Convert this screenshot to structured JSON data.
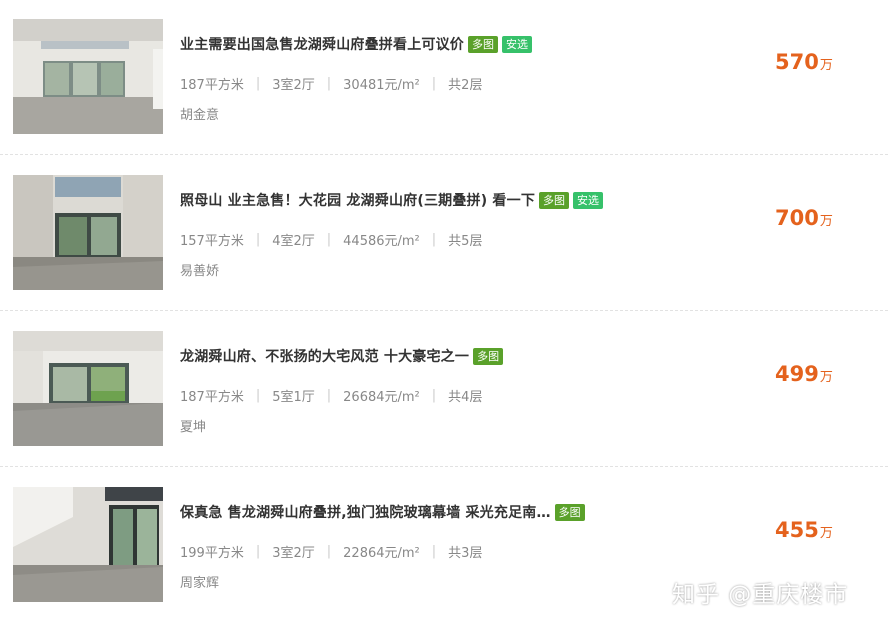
{
  "listings": [
    {
      "title": "业主需要出国急售龙湖舜山府叠拼看上可议价",
      "tags": [
        "多图",
        "安选"
      ],
      "area": "187平方米",
      "layout": "3室2厅",
      "unit_price": "30481元/m²",
      "floors": "共2层",
      "agent": "胡金意",
      "price": "570",
      "price_unit": "万"
    },
    {
      "title": "照母山 业主急售！大花园 龙湖舜山府(三期叠拼) 看一下",
      "tags": [
        "多图",
        "安选"
      ],
      "area": "157平方米",
      "layout": "4室2厅",
      "unit_price": "44586元/m²",
      "floors": "共5层",
      "agent": "易善娇",
      "price": "700",
      "price_unit": "万"
    },
    {
      "title": "龙湖舜山府、不张扬的大宅风范 十大豪宅之一",
      "tags": [
        "多图"
      ],
      "area": "187平方米",
      "layout": "5室1厅",
      "unit_price": "26684元/m²",
      "floors": "共4层",
      "agent": "夏坤",
      "price": "499",
      "price_unit": "万"
    },
    {
      "title": "保真急 售龙湖舜山府叠拼,独门独院玻璃幕墙 采光充足南…",
      "tags": [
        "多图"
      ],
      "area": "199平方米",
      "layout": "3室2厅",
      "unit_price": "22864元/m²",
      "floors": "共3层",
      "agent": "周家辉",
      "price": "455",
      "price_unit": "万"
    }
  ],
  "separator": "|",
  "watermark": "知乎 @重庆楼市",
  "colors": {
    "price": "#e4621d",
    "tag_multi": "#5aa12a",
    "tag_select": "#36c16a",
    "title": "#333333",
    "meta": "#888888"
  }
}
